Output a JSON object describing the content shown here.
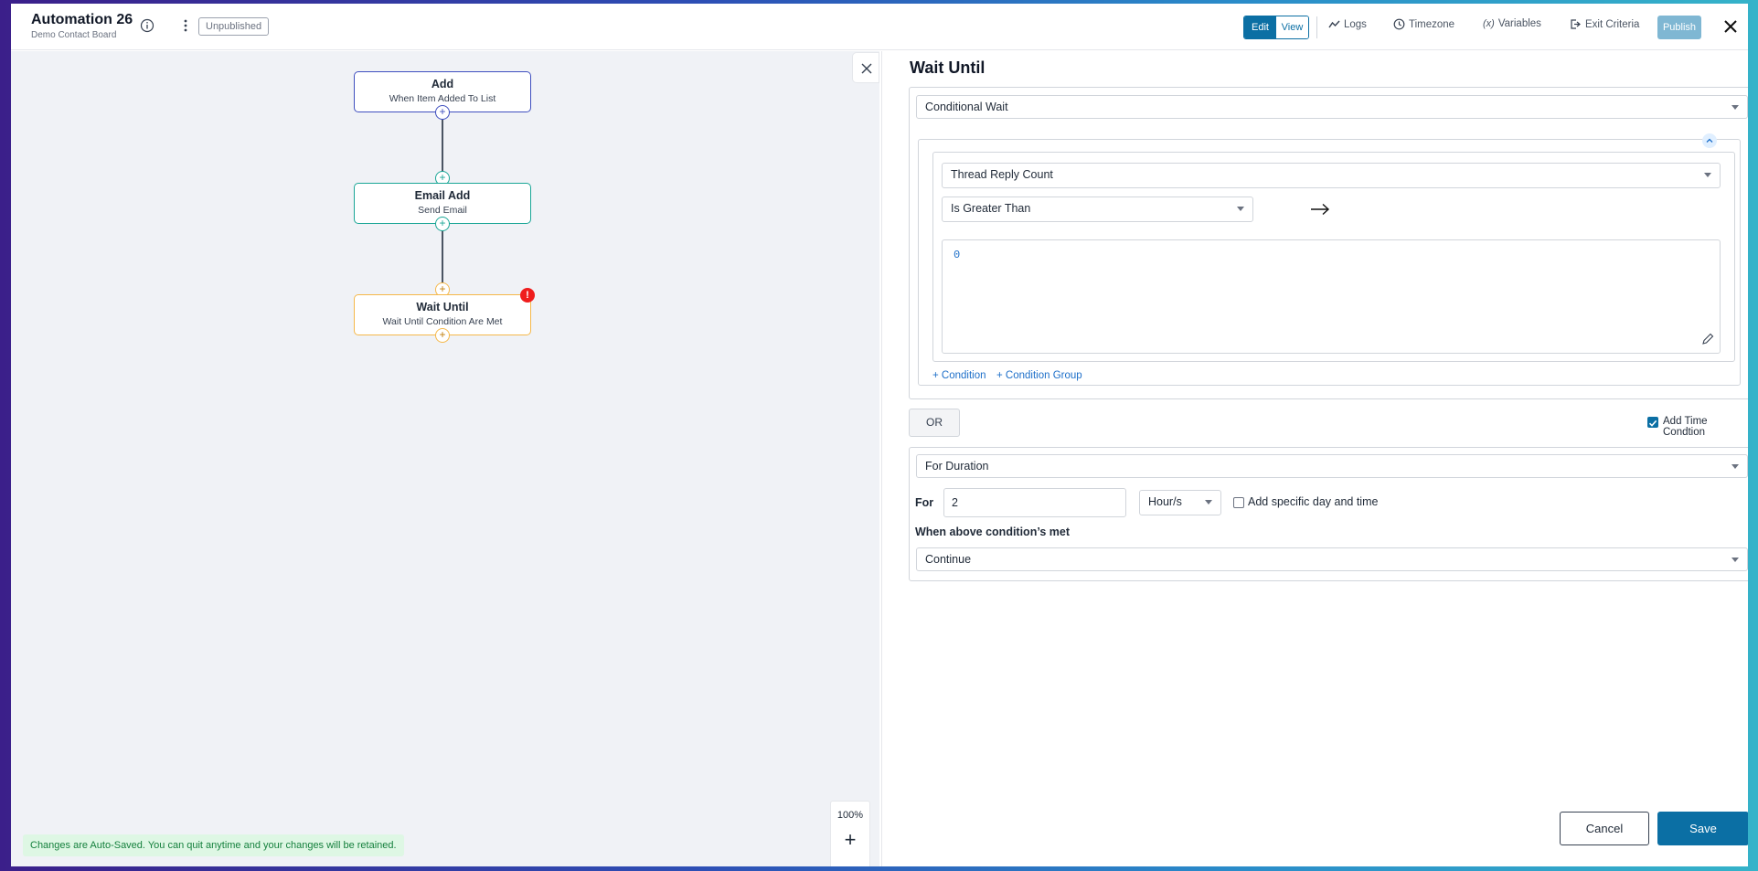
{
  "header": {
    "title": "Automation 26",
    "subtitle": "Demo Contact Board",
    "status": "Unpublished",
    "mode": {
      "edit": "Edit",
      "view": "View",
      "active": "edit"
    },
    "links": {
      "logs": "Logs",
      "timezone": "Timezone",
      "variables": "Variables",
      "exit_criteria": "Exit Criteria"
    },
    "publish": "Publish"
  },
  "canvas": {
    "nodes": [
      {
        "title": "Add",
        "subtitle": "When Item Added To List"
      },
      {
        "title": "Email Add",
        "subtitle": "Send Email"
      },
      {
        "title": "Wait Until",
        "subtitle": "Wait Until Condition Are Met",
        "error": "!"
      }
    ],
    "autosave": "Changes are Auto-Saved. You can quit anytime and your changes will be retained.",
    "zoom": {
      "level": "100%",
      "in": "+",
      "out": "−"
    }
  },
  "panel": {
    "title": "Wait Until",
    "wait_type": "Conditional Wait",
    "condition": {
      "field": "Thread Reply Count",
      "operator": "Is Greater Than",
      "value": "0"
    },
    "add_condition": "+ Condition",
    "add_condition_group": "+ Condition Group",
    "or_label": "OR",
    "add_time_condition": {
      "label": "Add Time Condtion",
      "checked": true
    },
    "time": {
      "type": "For Duration",
      "for_label": "For",
      "for_value": "2",
      "unit": "Hour/s",
      "specific_day": {
        "label": "Add specific day and time",
        "checked": false
      }
    },
    "when_met_label": "When above condition’s met",
    "when_met_action": "Continue",
    "cancel": "Cancel",
    "save": "Save"
  },
  "colors": {
    "primary": "#0b6fa4",
    "node_add": "#3f4fbf",
    "node_email": "#1aa696",
    "node_wait": "#f5b84a",
    "error": "#ef1d1d"
  }
}
